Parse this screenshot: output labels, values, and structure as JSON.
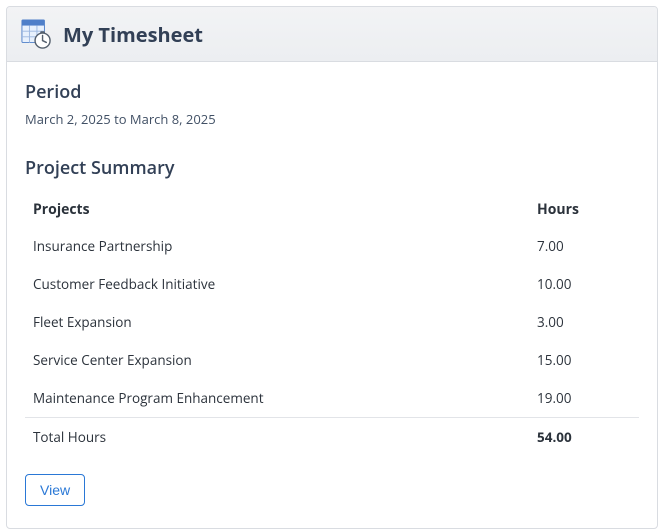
{
  "header": {
    "title": "My Timesheet"
  },
  "period": {
    "label": "Period",
    "value": "March 2, 2025 to March 8, 2025"
  },
  "summary": {
    "label": "Project Summary",
    "columns": {
      "projects": "Projects",
      "hours": "Hours"
    },
    "rows": [
      {
        "project": "Insurance Partnership",
        "hours": "7.00"
      },
      {
        "project": "Customer Feedback Initiative",
        "hours": "10.00"
      },
      {
        "project": "Fleet Expansion",
        "hours": "3.00"
      },
      {
        "project": "Service Center Expansion",
        "hours": "15.00"
      },
      {
        "project": "Maintenance Program Enhancement",
        "hours": "19.00"
      }
    ],
    "total": {
      "label": "Total Hours",
      "value": "54.00"
    }
  },
  "actions": {
    "view": "View"
  }
}
